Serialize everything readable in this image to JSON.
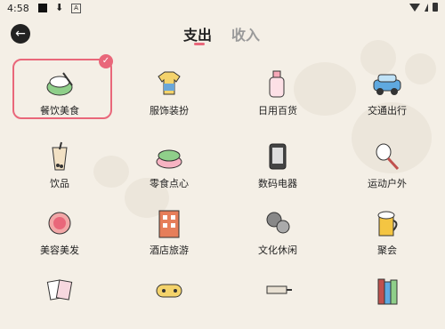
{
  "status": {
    "time": "4:58",
    "box_glyph": "A"
  },
  "header": {
    "back_glyph": "←",
    "tabs": [
      {
        "label": "支出"
      },
      {
        "label": "收入"
      }
    ]
  },
  "categories": [
    {
      "label": "餐饮美食",
      "icon": "rice-bowl-icon"
    },
    {
      "label": "服饰装扮",
      "icon": "clothing-icon"
    },
    {
      "label": "日用百货",
      "icon": "bottle-icon"
    },
    {
      "label": "交通出行",
      "icon": "car-icon"
    },
    {
      "label": "饮品",
      "icon": "bubble-tea-icon"
    },
    {
      "label": "零食点心",
      "icon": "dessert-icon"
    },
    {
      "label": "数码电器",
      "icon": "phone-icon"
    },
    {
      "label": "运动户外",
      "icon": "racket-icon"
    },
    {
      "label": "美容美发",
      "icon": "compact-icon"
    },
    {
      "label": "酒店旅游",
      "icon": "hotel-icon"
    },
    {
      "label": "文化休闲",
      "icon": "film-icon"
    },
    {
      "label": "聚会",
      "icon": "beer-icon"
    },
    {
      "label": "",
      "icon": "cards-icon"
    },
    {
      "label": "",
      "icon": "gamepad-icon"
    },
    {
      "label": "",
      "icon": "syringe-icon"
    },
    {
      "label": "",
      "icon": "books-icon"
    }
  ],
  "selected_index": 0,
  "colors": {
    "accent": "#e9677a",
    "background": "#f4efe6"
  }
}
